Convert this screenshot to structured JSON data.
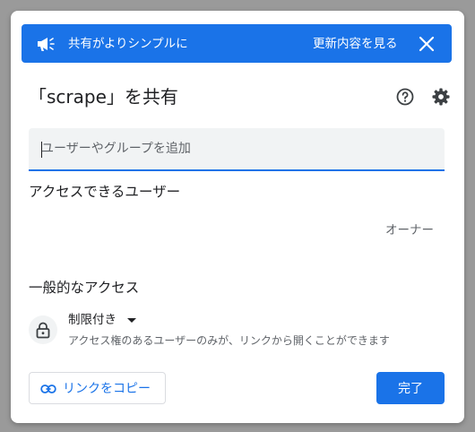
{
  "banner": {
    "text": "共有がよりシンプルに",
    "link_label": "更新内容を見る",
    "icons": {
      "leading": "megaphone-icon",
      "close": "close-icon"
    }
  },
  "dialog": {
    "title": "「scrape」を共有",
    "icons": {
      "help": "help-icon",
      "settings": "gear-icon"
    }
  },
  "add_people": {
    "placeholder": "ユーザーやグループを追加"
  },
  "people_section": {
    "heading": "アクセスできるユーザー",
    "owner_role": "オーナー"
  },
  "general_access": {
    "heading": "一般的なアクセス",
    "selected": "制限付き",
    "description": "アクセス権のあるユーザーのみが、リンクから開くことができます",
    "icon": "lock-icon"
  },
  "footer": {
    "copy_link_label": "リンクをコピー",
    "copy_link_icon": "link-icon",
    "done_label": "完了"
  },
  "colors": {
    "accent": "#1a73e8",
    "backdrop": "#9a9a9a"
  }
}
